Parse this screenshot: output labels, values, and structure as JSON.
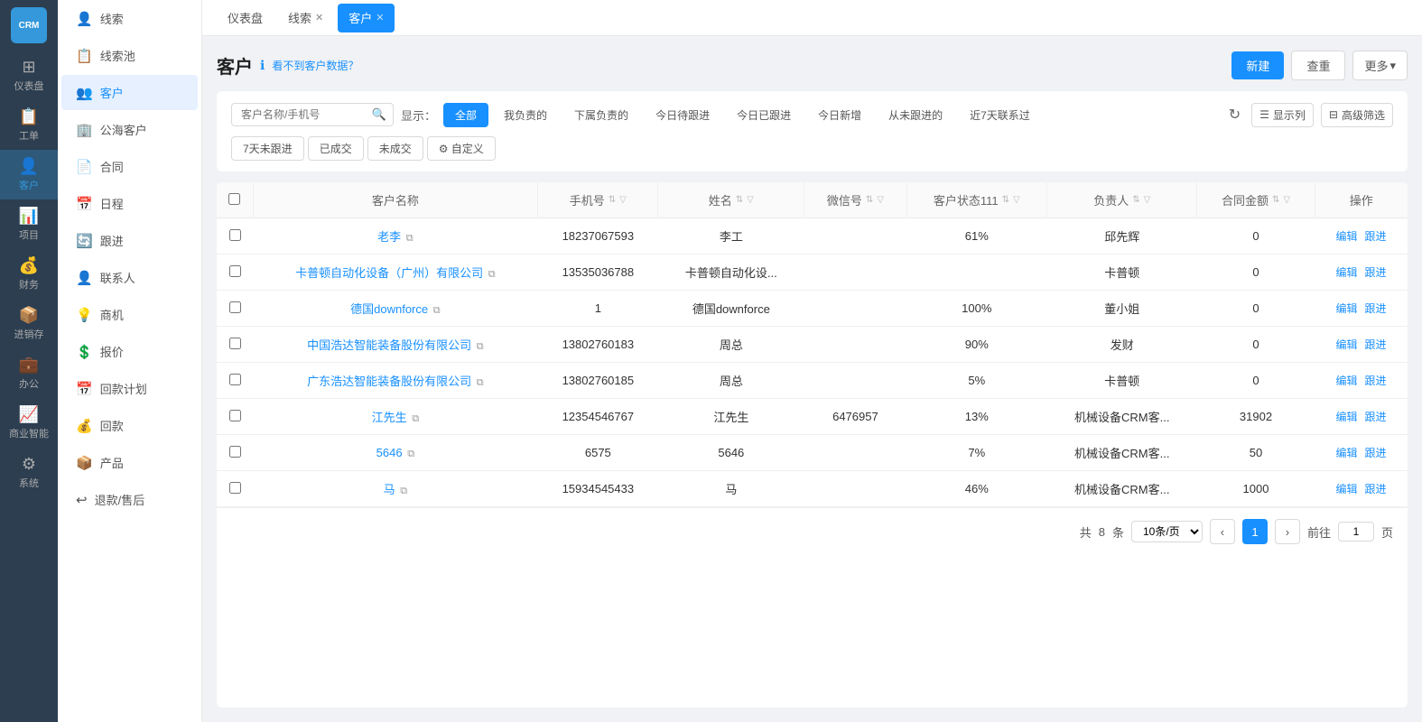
{
  "logo": {
    "text": "CRM"
  },
  "icon_nav": [
    {
      "id": "dashboard",
      "icon": "⊞",
      "label": "仪表盘"
    },
    {
      "id": "order",
      "icon": "📋",
      "label": "工单"
    },
    {
      "id": "customer",
      "icon": "👤",
      "label": "客户",
      "active": true
    },
    {
      "id": "project",
      "icon": "📊",
      "label": "项目"
    },
    {
      "id": "finance",
      "icon": "💰",
      "label": "财务"
    },
    {
      "id": "inventory",
      "icon": "📦",
      "label": "进销存"
    },
    {
      "id": "office",
      "icon": "💼",
      "label": "办公"
    },
    {
      "id": "bi",
      "icon": "📈",
      "label": "商业智能"
    },
    {
      "id": "system",
      "icon": "⚙",
      "label": "系统"
    }
  ],
  "sidebar": {
    "items": [
      {
        "id": "leads",
        "icon": "👤",
        "label": "线索"
      },
      {
        "id": "leads-pool",
        "icon": "📋",
        "label": "线索池"
      },
      {
        "id": "customer",
        "icon": "👥",
        "label": "客户",
        "active": true
      },
      {
        "id": "public-customer",
        "icon": "🏢",
        "label": "公海客户"
      },
      {
        "id": "contract",
        "icon": "📄",
        "label": "合同"
      },
      {
        "id": "schedule",
        "icon": "📅",
        "label": "日程"
      },
      {
        "id": "followup",
        "icon": "🔄",
        "label": "跟进"
      },
      {
        "id": "contact",
        "icon": "👤",
        "label": "联系人"
      },
      {
        "id": "opportunity",
        "icon": "💡",
        "label": "商机"
      },
      {
        "id": "quote",
        "icon": "💲",
        "label": "报价"
      },
      {
        "id": "payment-plan",
        "icon": "📅",
        "label": "回款计划"
      },
      {
        "id": "payment",
        "icon": "💰",
        "label": "回款"
      },
      {
        "id": "product",
        "icon": "📦",
        "label": "产品"
      },
      {
        "id": "refund",
        "icon": "↩",
        "label": "退款/售后"
      }
    ]
  },
  "tabs": [
    {
      "id": "dashboard",
      "label": "仪表盘",
      "closable": false
    },
    {
      "id": "leads",
      "label": "线索",
      "closable": true
    },
    {
      "id": "customer",
      "label": "客户",
      "closable": true,
      "active": true
    }
  ],
  "page": {
    "title": "客户",
    "hint": "看不到客户数据？",
    "new_btn": "新建",
    "reset_btn": "查重",
    "more_btn": "更多"
  },
  "search": {
    "placeholder": "客户名称/手机号"
  },
  "display_label": "显示：",
  "filter_tabs_row1": [
    {
      "id": "all",
      "label": "全部",
      "active": true
    },
    {
      "id": "mine",
      "label": "我负责的"
    },
    {
      "id": "sub",
      "label": "下属负责的"
    },
    {
      "id": "today-pending",
      "label": "今日待跟进"
    },
    {
      "id": "today-done",
      "label": "今日已跟进"
    },
    {
      "id": "today-new",
      "label": "今日新增"
    },
    {
      "id": "never",
      "label": "从未跟进的"
    },
    {
      "id": "week-contact",
      "label": "近7天联系过"
    }
  ],
  "filter_tabs_row2": [
    {
      "id": "7day-no",
      "label": "7天未跟进"
    },
    {
      "id": "closed",
      "label": "已成交"
    },
    {
      "id": "not-closed",
      "label": "未成交"
    },
    {
      "id": "custom",
      "label": "⚙ 自定义"
    }
  ],
  "col_btn": "显示列",
  "advanced_btn": "高级筛选",
  "table": {
    "columns": [
      {
        "id": "name",
        "label": "客户名称"
      },
      {
        "id": "phone",
        "label": "手机号"
      },
      {
        "id": "contact-name",
        "label": "姓名"
      },
      {
        "id": "wechat",
        "label": "微信号"
      },
      {
        "id": "status",
        "label": "客户状态111"
      },
      {
        "id": "owner",
        "label": "负责人"
      },
      {
        "id": "amount",
        "label": "合同金额"
      },
      {
        "id": "action",
        "label": "操作"
      }
    ],
    "rows": [
      {
        "id": 1,
        "name": "老李",
        "phone": "18237067593",
        "contact_name": "李工",
        "wechat": "",
        "status": "61%",
        "owner": "邱先辉",
        "amount": "0",
        "copy": true
      },
      {
        "id": 2,
        "name": "卡普顿自动化设备（广州）有限公司",
        "phone": "13535036788",
        "contact_name": "卡普顿自动化设...",
        "wechat": "",
        "status": "",
        "owner": "卡普顿",
        "amount": "0",
        "copy": true
      },
      {
        "id": 3,
        "name": "德国downforce",
        "phone": "1",
        "contact_name": "德国downforce",
        "wechat": "",
        "status": "100%",
        "owner": "董小姐",
        "amount": "0",
        "copy": true
      },
      {
        "id": 4,
        "name": "中国浩达智能装备股份有限公司",
        "phone": "13802760183",
        "contact_name": "周总",
        "wechat": "",
        "status": "90%",
        "owner": "发财",
        "amount": "0",
        "copy": true
      },
      {
        "id": 5,
        "name": "广东浩达智能装备股份有限公司",
        "phone": "13802760185",
        "contact_name": "周总",
        "wechat": "",
        "status": "5%",
        "owner": "卡普顿",
        "amount": "0",
        "copy": true
      },
      {
        "id": 6,
        "name": "江先生",
        "phone": "12354546767",
        "contact_name": "江先生",
        "wechat": "6476957",
        "status": "13%",
        "owner": "机械设备CRM客...",
        "amount": "31902",
        "copy": true
      },
      {
        "id": 7,
        "name": "5646",
        "phone": "6575",
        "contact_name": "5646",
        "wechat": "",
        "status": "7%",
        "owner": "机械设备CRM客...",
        "amount": "50",
        "copy": true
      },
      {
        "id": 8,
        "name": "马",
        "phone": "15934545433",
        "contact_name": "马",
        "wechat": "",
        "status": "46%",
        "owner": "机械设备CRM客...",
        "amount": "1000",
        "copy": true
      }
    ]
  },
  "pagination": {
    "total_label": "共",
    "total": "8",
    "total_unit": "条",
    "page_size": "10条/页",
    "prev_label": "‹",
    "next_label": "›",
    "current_page": 1,
    "jump_label": "前往",
    "jump_value": "1",
    "page_unit": "页"
  }
}
